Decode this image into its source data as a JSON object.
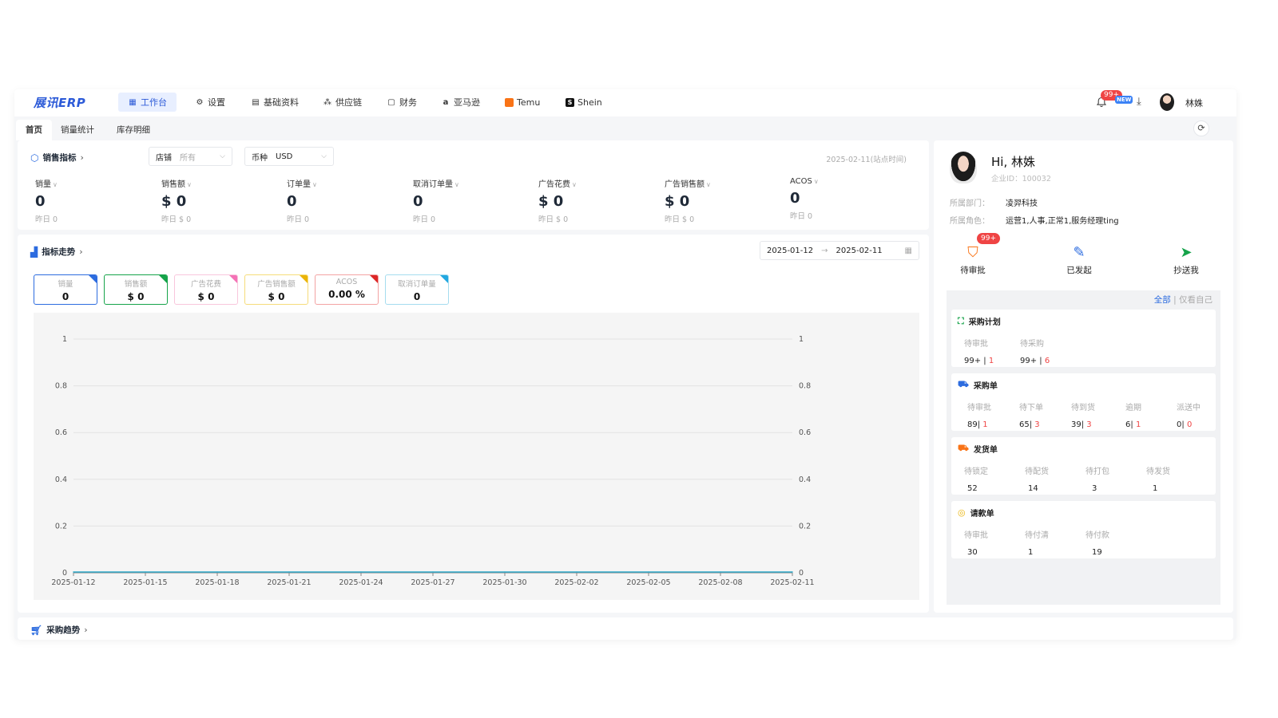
{
  "app": {
    "logo": "展讯ERP"
  },
  "nav": [
    {
      "label": "工作台",
      "icon": "grid-icon",
      "glyph": "▦",
      "active": true
    },
    {
      "label": "设置",
      "icon": "gear-icon",
      "glyph": "⚙"
    },
    {
      "label": "基础资料",
      "icon": "document-icon",
      "glyph": "▤"
    },
    {
      "label": "供应链",
      "icon": "network-icon",
      "glyph": "⁂"
    },
    {
      "label": "财务",
      "icon": "finance-icon",
      "glyph": "▢"
    },
    {
      "label": "亚马逊",
      "icon": "amazon-icon",
      "glyph": "a"
    },
    {
      "label": "Temu",
      "icon": "temu-icon"
    },
    {
      "label": "Shein",
      "icon": "shein-icon"
    }
  ],
  "header": {
    "bell_badge": "99+",
    "new_badge": "NEW",
    "user_name": "林姝"
  },
  "tabs": [
    "首页",
    "销量统计",
    "库存明细"
  ],
  "sales": {
    "title": "销售指标",
    "store_label": "店铺",
    "store_placeholder": "所有",
    "currency_label": "币种",
    "currency_value": "USD",
    "date_note": "2025-02-11(站点时间)",
    "metrics": [
      {
        "label": "销量",
        "value": "0",
        "yesterday": "昨日 0"
      },
      {
        "label": "销售额",
        "value": "$ 0",
        "yesterday": "昨日 $ 0"
      },
      {
        "label": "订单量",
        "value": "0",
        "yesterday": "昨日 0"
      },
      {
        "label": "取消订单量",
        "value": "0",
        "yesterday": "昨日 0"
      },
      {
        "label": "广告花费",
        "value": "$ 0",
        "yesterday": "昨日 $ 0"
      },
      {
        "label": "广告销售额",
        "value": "$ 0",
        "yesterday": "昨日 $ 0"
      },
      {
        "label": "ACOS",
        "value": "0",
        "yesterday": "昨日 0"
      }
    ]
  },
  "trend": {
    "title": "指标走势",
    "date_start": "2025-01-12",
    "date_end": "2025-02-11",
    "kpis": [
      {
        "label": "销量",
        "value": "0",
        "color": "#2d6cdf"
      },
      {
        "label": "销售额",
        "value": "$ 0",
        "color": "#16a34a"
      },
      {
        "label": "广告花费",
        "value": "$ 0",
        "color": "#f472b6"
      },
      {
        "label": "广告销售额",
        "value": "$ 0",
        "color": "#eab308"
      },
      {
        "label": "ACOS",
        "value": "0.00 %",
        "color": "#dc2626"
      },
      {
        "label": "取消订单量",
        "value": "0",
        "color": "#22a7e0"
      }
    ]
  },
  "chart_data": {
    "type": "line",
    "x": [
      "2025-01-12",
      "2025-01-15",
      "2025-01-18",
      "2025-01-21",
      "2025-01-24",
      "2025-01-27",
      "2025-01-30",
      "2025-02-02",
      "2025-02-05",
      "2025-02-08",
      "2025-02-11"
    ],
    "series": [
      {
        "values": [
          0,
          0,
          0,
          0,
          0,
          0,
          0,
          0,
          0,
          0,
          0
        ],
        "color": "#2fa9c9"
      }
    ],
    "ylim": [
      0,
      1
    ],
    "yticks": [
      "0",
      "0.2",
      "0.4",
      "0.6",
      "0.8",
      "1"
    ],
    "y2ticks": [
      "0",
      "0.2",
      "0.4",
      "0.6",
      "0.8",
      "1"
    ],
    "grid": true
  },
  "profile": {
    "greeting": "Hi, 林姝",
    "corp_id": "企业ID：100032",
    "dept_label": "所属部门：",
    "dept_value": "凌羿科技",
    "role_label": "所属角色：",
    "role_value": "运营1,人事,正常1,服务经理ting"
  },
  "quick": [
    {
      "label": "待审批",
      "icon": "stamp-icon",
      "glyph": "⛉",
      "badge": "99+",
      "color": "#f97316"
    },
    {
      "label": "已发起",
      "icon": "form-icon",
      "glyph": "✎",
      "color": "#2d6cdf"
    },
    {
      "label": "抄送我",
      "icon": "send-icon",
      "glyph": "➤",
      "color": "#16a34a"
    }
  ],
  "filter": {
    "all": "全部",
    "separator": "|",
    "mine": "仅看自己"
  },
  "todos": [
    {
      "title": "采购计划",
      "icon": "cart-bag-icon",
      "glyph": "⛶",
      "color": "#16a34a",
      "cols": [
        {
          "h": "待审批",
          "v": "99+ ",
          "sep": "| ",
          "r": "1"
        },
        {
          "h": "待采购",
          "v": "99+ ",
          "sep": "| ",
          "r": "6"
        }
      ]
    },
    {
      "title": "采购单",
      "icon": "cart-icon",
      "glyph": "⛟",
      "color": "#2d6cdf",
      "cols": [
        {
          "h": "待审批",
          "v": "89",
          "sep": "| ",
          "r": "1"
        },
        {
          "h": "待下单",
          "v": "65",
          "sep": "| ",
          "r": "3"
        },
        {
          "h": "待到货",
          "v": "39",
          "sep": "| ",
          "r": "3"
        },
        {
          "h": "逾期",
          "v": "6",
          "sep": "| ",
          "r": "1"
        },
        {
          "h": "派送中",
          "v": "0",
          "sep": "| ",
          "r": "0"
        }
      ]
    },
    {
      "title": "发货单",
      "icon": "truck-icon",
      "glyph": "⛟",
      "color": "#f97316",
      "cols": [
        {
          "h": "待锁定",
          "v": "52"
        },
        {
          "h": "待配货",
          "v": "14"
        },
        {
          "h": "待打包",
          "v": "3"
        },
        {
          "h": "待发货",
          "v": "1"
        }
      ]
    },
    {
      "title": "请款单",
      "icon": "coin-icon",
      "glyph": "◎",
      "color": "#eab308",
      "cols": [
        {
          "h": "待审批",
          "v": "30"
        },
        {
          "h": "待付清",
          "v": "1"
        },
        {
          "h": "待付款",
          "v": "19"
        }
      ]
    }
  ],
  "purchase": {
    "title": "采购趋势"
  }
}
